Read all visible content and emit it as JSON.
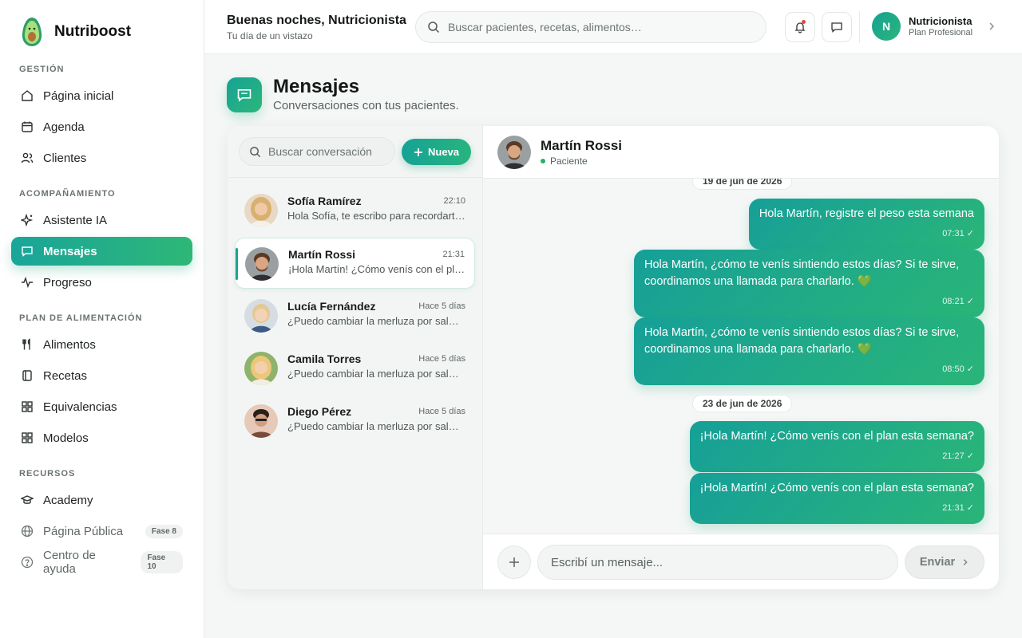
{
  "brand": {
    "name": "Nutriboost"
  },
  "sidebar": {
    "sections": [
      {
        "title": "GESTIÓN"
      },
      {
        "title": "ACOMPAÑAMIENTO"
      },
      {
        "title": "PLAN DE ALIMENTACIÓN"
      },
      {
        "title": "RECURSOS"
      }
    ],
    "items": [
      {
        "label": "Página inicial",
        "icon": "home-icon"
      },
      {
        "label": "Agenda",
        "icon": "calendar-icon"
      },
      {
        "label": "Clientes",
        "icon": "users-icon"
      },
      {
        "label": "Asistente IA",
        "icon": "sparkle-icon"
      },
      {
        "label": "Mensajes",
        "icon": "chat-icon",
        "active": true
      },
      {
        "label": "Progreso",
        "icon": "activity-icon"
      },
      {
        "label": "Alimentos",
        "icon": "utensils-icon"
      },
      {
        "label": "Recetas",
        "icon": "book-icon"
      },
      {
        "label": "Equivalencias",
        "icon": "grid-icon"
      },
      {
        "label": "Modelos",
        "icon": "grid-icon"
      },
      {
        "label": "Academy",
        "icon": "graduation-cap-icon"
      },
      {
        "label": "Página Pública",
        "icon": "globe-icon",
        "badge": "Fase 8"
      },
      {
        "label": "Centro de ayuda",
        "icon": "help-circle-icon",
        "badge": "Fase 10"
      }
    ]
  },
  "topbar": {
    "greeting": "Buenas noches, Nutricionista",
    "subtitle": "Tu día de un vistazo",
    "search_placeholder": "Buscar pacientes, recetas, alimentos…",
    "user": {
      "initial": "N",
      "name": "Nutricionista",
      "plan": "Plan Profesional"
    }
  },
  "page": {
    "title": "Mensajes",
    "subtitle": "Conversaciones con tus pacientes."
  },
  "conversations": {
    "search_placeholder": "Buscar conversación",
    "new_label": "Nueva",
    "items": [
      {
        "name": "Sofía Ramírez",
        "time": "22:10",
        "preview": "Hola Sofía, te escribo para recordarte…"
      },
      {
        "name": "Martín Rossi",
        "time": "21:31",
        "preview": "¡Hola Martín! ¿Cómo venís con el plan…",
        "active": true
      },
      {
        "name": "Lucía Fernández",
        "time": "Hace 5 días",
        "preview": "¿Puedo cambiar la merluza por salmón…"
      },
      {
        "name": "Camila Torres",
        "time": "Hace 5 días",
        "preview": "¿Puedo cambiar la merluza por salmón…"
      },
      {
        "name": "Diego Pérez",
        "time": "Hace 5 días",
        "preview": "¿Puedo cambiar la merluza por salmón…"
      }
    ]
  },
  "chat": {
    "contact_name": "Martín Rossi",
    "contact_role": "Paciente",
    "dates": [
      "19 de jun de 2026",
      "23 de jun de 2026"
    ],
    "messages": [
      {
        "text": "Hola Martín, registre el peso esta semana",
        "time": "07:31"
      },
      {
        "text": "Hola Martín, ¿cómo te venís sintiendo estos días? Si te sirve, coordinamos una llamada para charlarlo. 💚",
        "time": "08:21"
      },
      {
        "text": "Hola Martín, ¿cómo te venís sintiendo estos días? Si te sirve, coordinamos una llamada para charlarlo. 💚",
        "time": "08:50"
      },
      {
        "text": "¡Hola Martín! ¿Cómo venís con el plan esta semana?",
        "time": "21:27"
      },
      {
        "text": "¡Hola Martín! ¿Cómo venís con el plan esta semana?",
        "time": "21:31"
      }
    ],
    "input_placeholder": "Escribí un mensaje...",
    "send_label": "Enviar"
  },
  "colors": {
    "accent_start": "#169f98",
    "accent_end": "#2ab578",
    "notification": "#e0463f",
    "online": "#22b36a"
  }
}
